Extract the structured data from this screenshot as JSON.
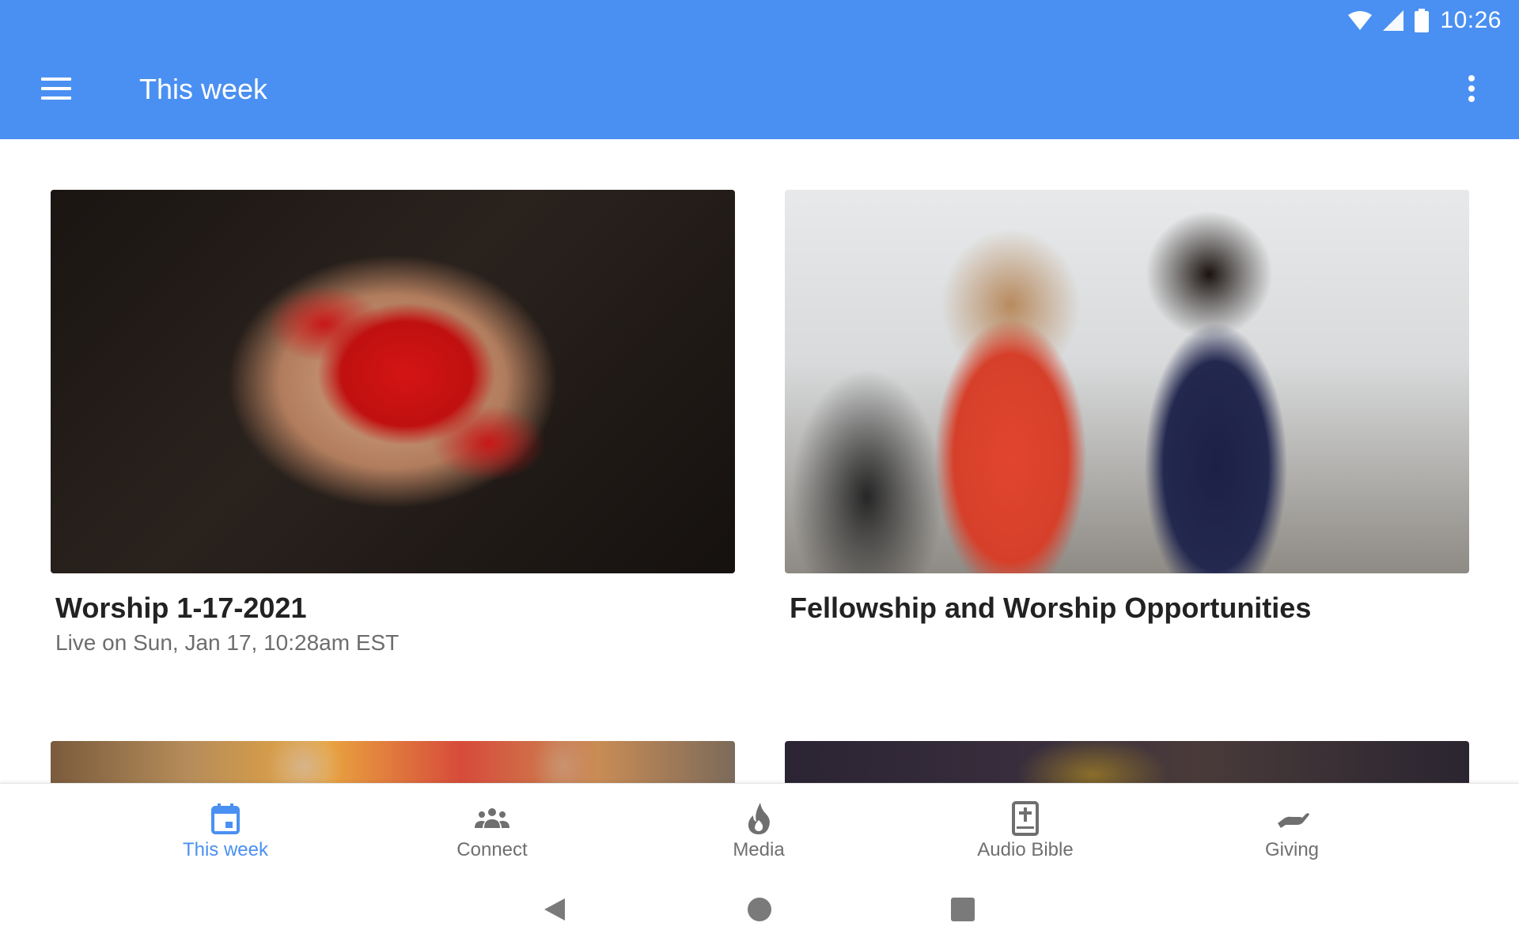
{
  "status_bar": {
    "time": "10:26"
  },
  "app_bar": {
    "title": "This week"
  },
  "cards": [
    {
      "title": "Worship 1-17-2021",
      "subtitle": "Live on Sun, Jan 17, 10:28am EST"
    },
    {
      "title": "Fellowship and Worship Opportunities",
      "subtitle": ""
    }
  ],
  "bottom_nav": {
    "items": [
      {
        "label": "This week",
        "icon": "calendar-icon",
        "active": true
      },
      {
        "label": "Connect",
        "icon": "group-icon",
        "active": false
      },
      {
        "label": "Media",
        "icon": "flame-icon",
        "active": false
      },
      {
        "label": "Audio Bible",
        "icon": "bible-icon",
        "active": false
      },
      {
        "label": "Giving",
        "icon": "giving-hand-icon",
        "active": false
      }
    ]
  },
  "colors": {
    "primary": "#4a90f2",
    "inactive": "#6f6f6f",
    "title_text": "#222222",
    "subtitle_text": "#6d6d6d"
  }
}
